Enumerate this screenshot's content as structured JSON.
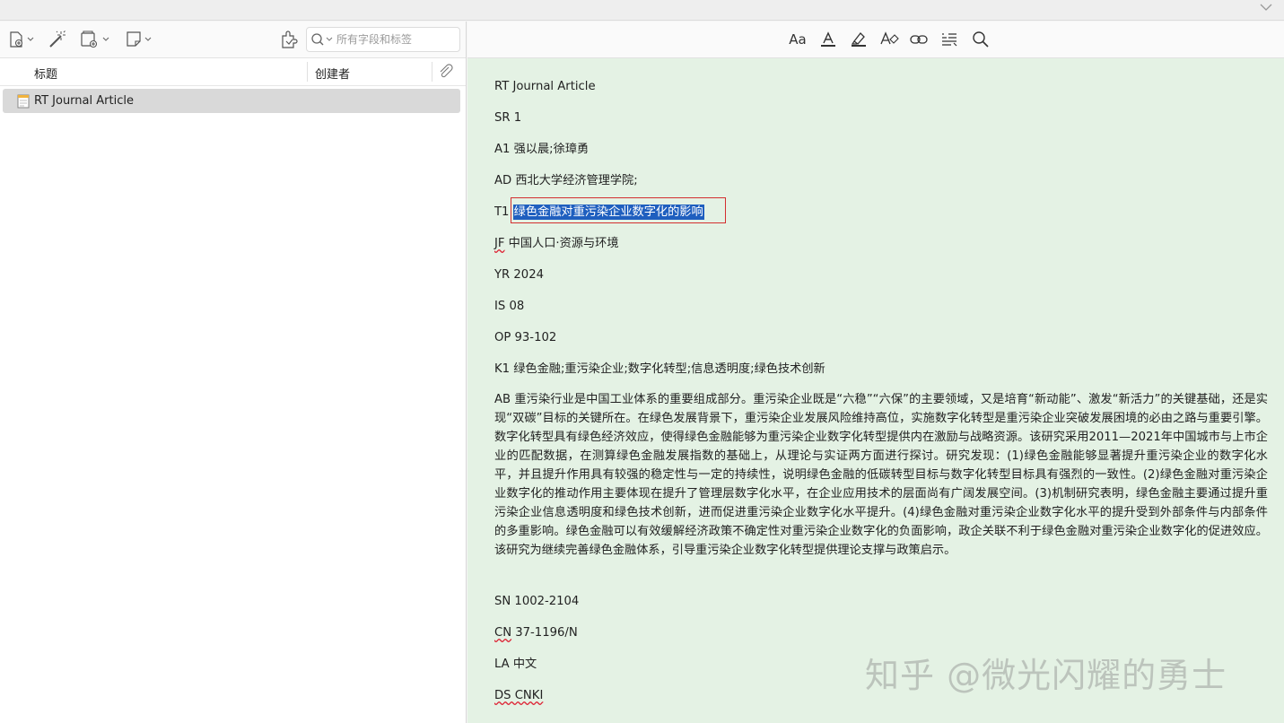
{
  "top_bar": {},
  "left_toolbar": {
    "buttons": [
      "new-item",
      "magic-wand",
      "add-attachment",
      "new-note"
    ],
    "search_placeholder": "所有字段和标签"
  },
  "columns": {
    "title": "标题",
    "creator": "创建者"
  },
  "items": [
    {
      "title": "RT Journal Article",
      "selected": true
    }
  ],
  "right_toolbar": {
    "font_label": "Aa"
  },
  "note": {
    "rt": "RT Journal Article",
    "sr": "SR 1",
    "a1": "A1   强以晨;徐璋勇",
    "ad": "AD 西北大学经济管理学院;",
    "t1_prefix": "T1 ",
    "t1_title": "绿色金融对重污染企业数字化的影响",
    "jf_tag": "JF",
    "jf_value": " 中国人口·资源与环境",
    "yr": "YR 2024",
    "is": "IS 08",
    "op": "OP 93-102",
    "k1": "K1 绿色金融;重污染企业;数字化转型;信息透明度;绿色技术创新",
    "ab": "AB 重污染行业是中国工业体系的重要组成部分。重污染企业既是“六稳”“六保”的主要领域，又是培育“新动能”、激发“新活力”的关键基础，还是实现“双碳”目标的关键所在。在绿色发展背景下，重污染企业发展风险维持高位，实施数字化转型是重污染企业突破发展困境的必由之路与重要引擎。数字化转型具有绿色经济效应，使得绿色金融能够为重污染企业数字化转型提供内在激励与战略资源。该研究采用2011—2021年中国城市与上市企业的匹配数据，在测算绿色金融发展指数的基础上，从理论与实证两方面进行探讨。研究发现：(1)绿色金融能够显著提升重污染企业的数字化水平，并且提升作用具有较强的稳定性与一定的持续性，说明绿色金融的低碳转型目标与数字化转型目标具有强烈的一致性。(2)绿色金融对重污染企业数字化的推动作用主要体现在提升了管理层数字化水平，在企业应用技术的层面尚有广阔发展空间。(3)机制研究表明，绿色金融主要通过提升重污染企业信息透明度和绿色技术创新，进而促进重污染企业数字化水平提升。(4)绿色金融对重污染企业数字化水平的提升受到外部条件与内部条件的多重影响。绿色金融可以有效缓解经济政策不确定性对重污染企业数字化的负面影响，政企关联不利于绿色金融对重污染企业数字化的促进效应。该研究为继续完善绿色金融体系，引导重污染企业数字化转型提供理论支撑与政策启示。",
    "sn": "SN 1002-2104",
    "cn_tag": "CN",
    "cn_value": " 37-1196/N",
    "la": "LA 中文",
    "ds_tag": "DS CNKI"
  },
  "watermark": "知乎 @微光闪耀的勇士"
}
